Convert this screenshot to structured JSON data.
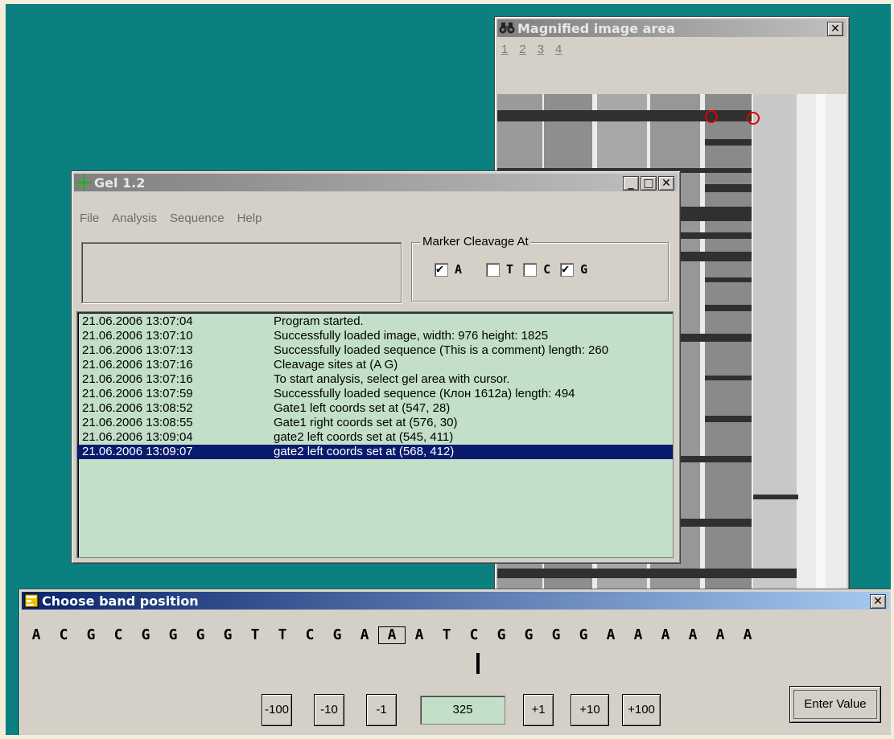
{
  "magnifier": {
    "title": "Magnified image area",
    "tabs": [
      "1",
      "2",
      "3",
      "4"
    ]
  },
  "gel_window": {
    "title": "Gel 1.2",
    "menu": {
      "file": "File",
      "analysis": "Analysis",
      "sequence": "Sequence",
      "help": "Help"
    },
    "marker_group": {
      "legend": "Marker Cleavage At",
      "checkboxes": [
        {
          "label": "A",
          "checked": true
        },
        {
          "label": "T",
          "checked": false
        },
        {
          "label": "C",
          "checked": false
        },
        {
          "label": "G",
          "checked": true
        }
      ]
    },
    "log": [
      {
        "time": "21.06.2006 13:07:04",
        "message": "Program started."
      },
      {
        "time": "21.06.2006 13:07:10",
        "message": "Successfully loaded image, width: 976 height: 1825"
      },
      {
        "time": "21.06.2006 13:07:13",
        "message": "Successfully loaded sequence (This is a comment) length: 260"
      },
      {
        "time": "21.06.2006 13:07:16",
        "message": "Cleavage sites at (A G)"
      },
      {
        "time": "21.06.2006 13:07:16",
        "message": "To start analysis, select gel area with cursor."
      },
      {
        "time": "21.06.2006 13:07:59",
        "message": "Successfully loaded sequence (Клон 1612a) length: 494"
      },
      {
        "time": "21.06.2006 13:08:52",
        "message": "Gate1 left coords set at (547, 28)"
      },
      {
        "time": "21.06.2006 13:08:55",
        "message": "Gate1 right coords set at (576, 30)"
      },
      {
        "time": "21.06.2006 13:09:04",
        "message": "gate2 left coords set at (545, 411)"
      },
      {
        "time": "21.06.2006 13:09:07",
        "message": "gate2 left coords set at (568, 412)",
        "selected": true
      }
    ]
  },
  "band_dialog": {
    "title": "Choose band position",
    "sequence": [
      "A",
      "C",
      "G",
      "C",
      "G",
      "G",
      "G",
      "G",
      "T",
      "T",
      "C",
      "G",
      "A",
      "A",
      "A",
      "T",
      "C",
      "G",
      "G",
      "G",
      "G",
      "A",
      "A",
      "A",
      "A",
      "A",
      "A"
    ],
    "selected_index": 13,
    "buttons": {
      "minus100": "-100",
      "minus10": "-10",
      "minus1": "-1",
      "plus1": "+1",
      "plus10": "+10",
      "plus100": "+100",
      "enter": "Enter Value"
    },
    "value": "325"
  },
  "colors": {
    "desktop": "#0b8080",
    "log_bg": "#c3dfc8",
    "selection": "#0a1a6e",
    "active_title": "#0a246a"
  }
}
